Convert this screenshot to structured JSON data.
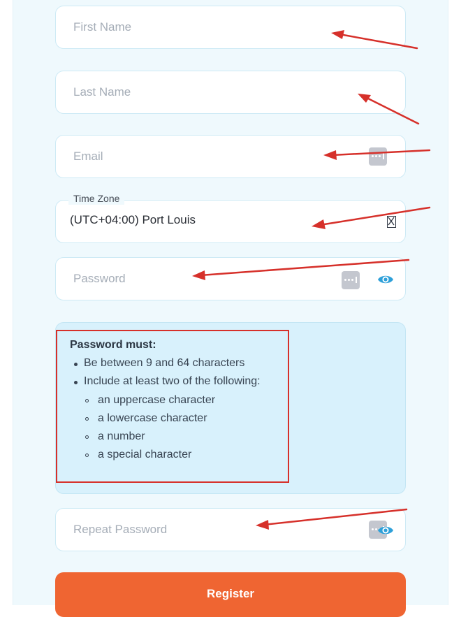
{
  "form": {
    "first_name": {
      "placeholder": "First Name"
    },
    "last_name": {
      "placeholder": "Last Name"
    },
    "email": {
      "placeholder": "Email"
    },
    "timezone": {
      "label": "Time Zone",
      "value": "(UTC+04:00) Port Louis"
    },
    "password": {
      "placeholder": "Password"
    },
    "repeat_password": {
      "placeholder": "Repeat Password"
    },
    "register_label": "Register"
  },
  "requirements": {
    "title": "Password must:",
    "items": [
      "Be between 9 and 64 characters",
      "Include at least two of the following:"
    ],
    "subitems": [
      "an uppercase character",
      "a lowercase character",
      "a number",
      "a special character"
    ]
  },
  "icons": {
    "password_manager": "password-manager-icon",
    "reveal_password": "eye-icon",
    "timezone_clear": "clear-icon"
  },
  "colors": {
    "accent": "#ef6532",
    "panel_bg": "#eff9fd",
    "requirements_bg": "#d8f1fc",
    "annotation_red": "#d6302a",
    "eye_blue": "#2ea0d9"
  }
}
